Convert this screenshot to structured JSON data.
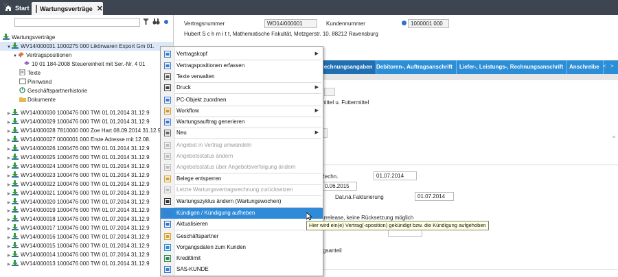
{
  "tabs": {
    "start": "Start",
    "active": "Wartungsverträge"
  },
  "tree": {
    "root": "Wartungsverträge",
    "selected": "WV14/000031  1000275  000  Likörwaren Export Gm  01.",
    "positions": "Vertragspositionen",
    "position_item": "10  01  184-2008  Steuereinheit mit Ser.-Nr.  4  01",
    "children": [
      "Texte",
      "Pinnwand",
      "Geschäftspartnerhistorie",
      "Dokumente"
    ],
    "contracts": [
      "WV14/000030  1000476  000  TWI  01.01.2014  31.12.9",
      "WV14/000029  1000476  000  TWI  01.01.2014  31.12.9",
      "WV14/000028  7810000  000  Zoe Hart  08.09.2014  31.12.9",
      "WV14/000027  0000001  000  Erste Adresse mit  12.08.",
      "WV14/000026  1000476  000  TWI  01.01.2014  31.12.9",
      "WV14/000025  1000476  000  TWI  01.01.2014  31.12.9",
      "WV14/000024  1000476  000  TWI  01.01.2014  31.12.9",
      "WV14/000023  1000476  000  TWI  01.01.2014  31.12.9",
      "WV14/000022  1000476  000  TWI  01.01.2014  31.12.9",
      "WV14/000021  1000476  000  TWI  01.07.2014  31.12.9",
      "WV14/000020  1000476  000  TWI  01.07.2014  31.12.9",
      "WV14/000019  1000476  000  TWI  01.07.2014  31.12.9",
      "WV14/000018  1000476  000  TWI  01.07.2014  31.12.9",
      "WV14/000017  1000476  000  TWI  01.07.2014  31.12.9",
      "WV14/000016  1000476  000  TWI  01.07.2014  31.12.9",
      "WV14/000015  1000476  000  TWI  01.01.2014  31.12.9",
      "WV14/000014  1000476  000  TWI  01.07.2014  31.12.9",
      "WV14/000013  1000476  000  TWI  01.01.2014  31.12.9"
    ]
  },
  "header": {
    "contract_label": "Vertragsnummer",
    "contract_value": "WO14/000001",
    "customer_label": "Kundennummer",
    "customer_value": "1000001 000",
    "address": "Hubert S c h m i t t, Mathematische Fakultät, Metzgerstr. 10, 88212 Ravensburg"
  },
  "navtabs": [
    "Rechnungsangaben",
    "Debitoren-, Auftragsanschrift",
    "Liefer-, Leistungs-, Rechnungsanschrift",
    "Anschreibe"
  ],
  "detail": {
    "futtermittel": "mittel u. Futtermittel",
    "rechn_label": "Rechn.",
    "rechn_value": "01.07.2014",
    "date2": "0.06.2015",
    "fakt_label": "Dat.nä.Fakturierung",
    "fakt_value": "01.07.2014",
    "release_text": "orrelease, keine Rücksetzung möglich",
    "anteil": "tzungsanteil"
  },
  "menu": {
    "items": [
      {
        "label": "Vertragskopf",
        "submenu": true,
        "disabled": false
      },
      {
        "label": "Vertragspositionen erfassen",
        "submenu": false,
        "disabled": false
      },
      {
        "label": "Texte verwalten",
        "submenu": false,
        "disabled": false
      },
      {
        "label": "Druck",
        "submenu": true,
        "disabled": false
      },
      {
        "label": "PC-Objekt zuordnen",
        "submenu": false,
        "disabled": false
      },
      {
        "label": "Workflow",
        "submenu": true,
        "disabled": false
      },
      {
        "label": "Wartungsauftrag generieren",
        "submenu": false,
        "disabled": false
      },
      {
        "label": "Neu",
        "submenu": true,
        "disabled": false
      },
      {
        "label": "Angebot in Vertrag umwandeln",
        "submenu": false,
        "disabled": true
      },
      {
        "label": "Angebotsstatus ändern",
        "submenu": false,
        "disabled": true
      },
      {
        "label": "Angebotsstatus über Angebotsverfolgung ändern",
        "submenu": false,
        "disabled": true
      },
      {
        "label": "Belege entsperren",
        "submenu": false,
        "disabled": false
      },
      {
        "label": "Letzte Wartungsvertragsrechnung zurücksetzen",
        "submenu": false,
        "disabled": true
      },
      {
        "label": "Wartungszyklus ändern (Wartungswochen)",
        "submenu": false,
        "disabled": false
      },
      {
        "label": "Kündigen / Kündigung aufheben",
        "submenu": false,
        "disabled": false,
        "highlight": true
      },
      {
        "label": "Aktualisieren",
        "submenu": false,
        "disabled": false
      },
      {
        "label": "Geschäftspartner",
        "submenu": false,
        "disabled": false
      },
      {
        "label": "Vorgangsdaten zum Kunden",
        "submenu": false,
        "disabled": false
      },
      {
        "label": "Kreditlimit",
        "submenu": false,
        "disabled": false
      },
      {
        "label": "SAS-KUNDE",
        "submenu": false,
        "disabled": false
      }
    ]
  },
  "tooltip": "Hier wird ein(e) Vertrag(-sposition) gekündigt bzw. die Kündigung aufgehoben",
  "colors": {
    "accent": "#2f8ad8",
    "topbar": "#3d4650",
    "tabbar": "#2c8ed6"
  }
}
